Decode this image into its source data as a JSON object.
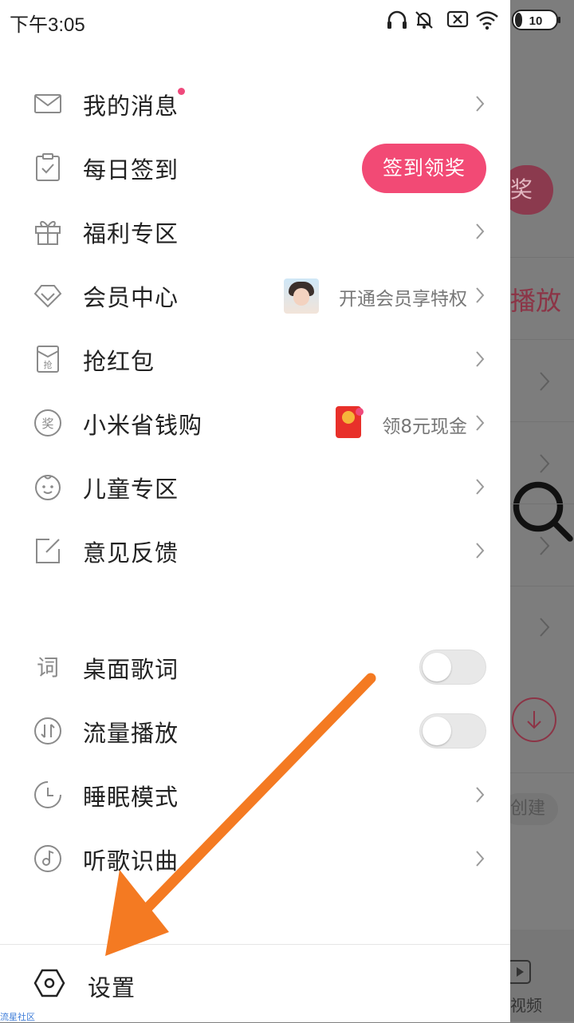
{
  "status_bar": {
    "time": "下午3:05",
    "battery": "10"
  },
  "menu": {
    "messages": {
      "label": "我的消息"
    },
    "checkin": {
      "label": "每日签到",
      "button": "签到领奖"
    },
    "welfare": {
      "label": "福利专区"
    },
    "vip": {
      "label": "会员中心",
      "sub": "开通会员享特权"
    },
    "redpacket": {
      "label": "抢红包"
    },
    "xiaomi_shop": {
      "label": "小米省钱购",
      "sub": "领8元现金"
    },
    "kids": {
      "label": "儿童专区"
    },
    "feedback": {
      "label": "意见反馈"
    },
    "desktop_lyrics": {
      "label": "桌面歌词",
      "on": false
    },
    "data_play": {
      "label": "流量播放",
      "on": false
    },
    "sleep_mode": {
      "label": "睡眠模式"
    },
    "song_recognition": {
      "label": "听歌识曲"
    }
  },
  "settings": {
    "label": "设置"
  },
  "background": {
    "pill_text": "奖",
    "red_text": "播放",
    "create_text": "创建",
    "video_label": "视频"
  },
  "watermark": "流星社区",
  "colors": {
    "accent": "#f24a75",
    "arrow": "#f47a22"
  },
  "icons": {
    "messages": "envelope-icon",
    "checkin": "clipboard-check-icon",
    "welfare": "gift-icon",
    "vip": "diamond-icon",
    "redpacket": "red-envelope-icon",
    "xiaomi_shop": "prize-badge-icon",
    "kids": "baby-face-icon",
    "feedback": "edit-icon",
    "desktop_lyrics": "lyrics-icon",
    "data_play": "data-transfer-icon",
    "sleep_mode": "clock-icon",
    "song_recognition": "music-disc-icon",
    "settings": "hexagon-gear-icon"
  }
}
